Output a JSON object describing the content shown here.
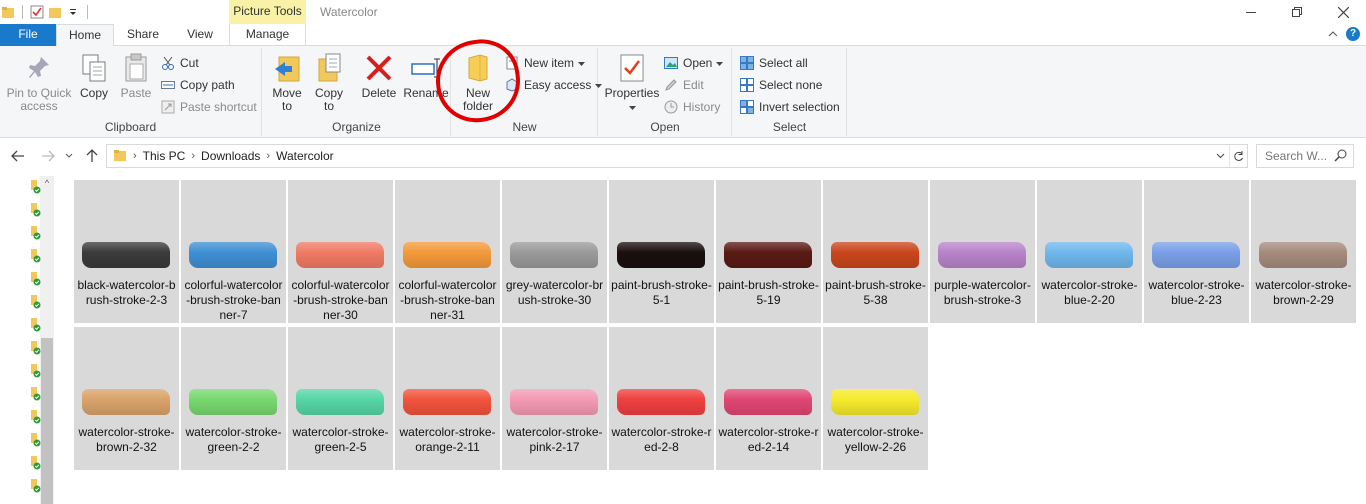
{
  "titlebar": {
    "context_tab": "Picture Tools",
    "window_title": "Watercolor"
  },
  "tabs": {
    "file": "File",
    "home": "Home",
    "share": "Share",
    "view": "View",
    "manage": "Manage"
  },
  "ribbon": {
    "clipboard": {
      "label": "Clipboard",
      "pin": "Pin to Quick access",
      "copy": "Copy",
      "paste": "Paste",
      "cut": "Cut",
      "copy_path": "Copy path",
      "paste_shortcut": "Paste shortcut"
    },
    "organize": {
      "label": "Organize",
      "move_to": "Move to",
      "copy_to": "Copy to",
      "delete": "Delete",
      "rename": "Rename"
    },
    "new": {
      "label": "New",
      "new_folder": "New folder",
      "new_item": "New item",
      "easy_access": "Easy access"
    },
    "open": {
      "label": "Open",
      "properties": "Properties",
      "open": "Open",
      "edit": "Edit",
      "history": "History"
    },
    "select": {
      "label": "Select",
      "select_all": "Select all",
      "select_none": "Select none",
      "invert": "Invert selection"
    }
  },
  "address": {
    "crumbs": [
      "This PC",
      "Downloads",
      "Watercolor"
    ],
    "search_placeholder": "Search W..."
  },
  "files": [
    {
      "name": "black-watercolor-brush-stroke-2-3",
      "color": "#3a3a3a"
    },
    {
      "name": "colorful-watercolor-brush-stroke-banner-7",
      "color": "#3f8fd4"
    },
    {
      "name": "colorful-watercolor-brush-stroke-banner-30",
      "color": "#f07a64"
    },
    {
      "name": "colorful-watercolor-brush-stroke-banner-31",
      "color": "#f39a3a"
    },
    {
      "name": "grey-watercolor-brush-stroke-30",
      "color": "#9a9a9a"
    },
    {
      "name": "paint-brush-stroke-5-1",
      "color": "#1a0f0f"
    },
    {
      "name": "paint-brush-stroke-5-19",
      "color": "#5a1a14"
    },
    {
      "name": "paint-brush-stroke-5-38",
      "color": "#c9461c"
    },
    {
      "name": "purple-watercolor-brush-stroke-3",
      "color": "#b883c9"
    },
    {
      "name": "watercolor-stroke-blue-2-20",
      "color": "#6fb7ec"
    },
    {
      "name": "watercolor-stroke-blue-2-23",
      "color": "#7a9fe8"
    },
    {
      "name": "watercolor-stroke-brown-2-29",
      "color": "#a58b7d"
    },
    {
      "name": "watercolor-stroke-brown-2-32",
      "color": "#d9a36a"
    },
    {
      "name": "watercolor-stroke-green-2-2",
      "color": "#78d86e"
    },
    {
      "name": "watercolor-stroke-green-2-5",
      "color": "#56d6a6"
    },
    {
      "name": "watercolor-stroke-orange-2-11",
      "color": "#f2533c"
    },
    {
      "name": "watercolor-stroke-pink-2-17",
      "color": "#f49ab4"
    },
    {
      "name": "watercolor-stroke-red-2-8",
      "color": "#ef4040"
    },
    {
      "name": "watercolor-stroke-red-2-14",
      "color": "#e04673"
    },
    {
      "name": "watercolor-stroke-yellow-2-26",
      "color": "#f6ea2c"
    }
  ],
  "colors": {
    "accent": "#1979ca",
    "context_tab": "#f8f1a6",
    "annotation": "#e00000",
    "tile_bg": "#d9d9d9"
  }
}
